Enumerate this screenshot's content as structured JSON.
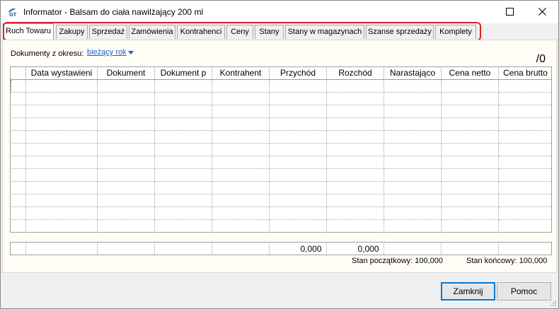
{
  "window": {
    "title": "Informator - Balsam do ciała nawilżający 200 ml"
  },
  "tabs": [
    {
      "label": "Ruch Towaru",
      "active": true
    },
    {
      "label": "Zakupy"
    },
    {
      "label": "Sprzedaż"
    },
    {
      "label": "Zamówienia"
    },
    {
      "label": "Kontrahenci"
    },
    {
      "label": "Ceny"
    },
    {
      "label": "Stany"
    },
    {
      "label": "Stany w magazynach"
    },
    {
      "label": "Szanse sprzedaży"
    },
    {
      "label": "Komplety"
    }
  ],
  "filter": {
    "label": "Dokumenty z okresu:",
    "period": "bieżący rok"
  },
  "record_count": "/0",
  "grid": {
    "columns": [
      "",
      "Data wystawieni",
      "Dokument",
      "Dokument p",
      "Kontrahent",
      "Przychód",
      "Rozchód",
      "Narastająco",
      "Cena netto",
      "Cena brutto"
    ],
    "empty_rows": 12
  },
  "totals": {
    "przychod": "0,000",
    "rozchod": "0,000"
  },
  "stock": {
    "start_label": "Stan początkowy: 100,000",
    "end_label": "Stan końcowy: 100,000"
  },
  "buttons": {
    "close": "Zamknij",
    "help": "Pomoc"
  },
  "colors": {
    "link": "#1a5fc9",
    "highlight": "#e0202a",
    "default_button": "#0078d7"
  }
}
